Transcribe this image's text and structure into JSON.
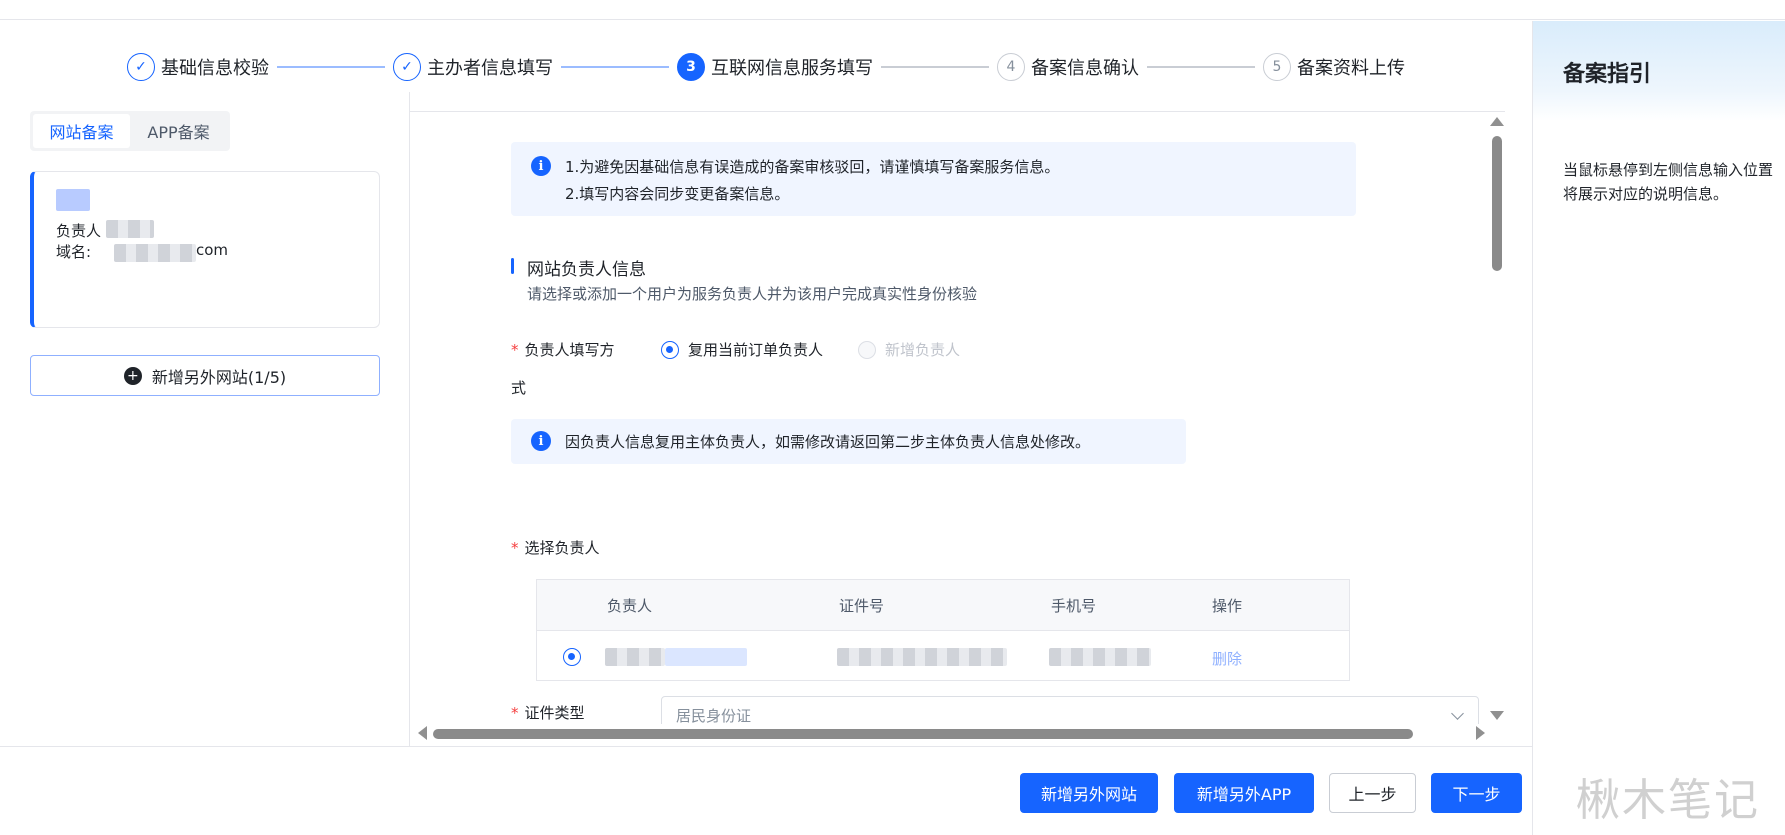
{
  "steps": [
    {
      "num": "✓",
      "label": "基础信息校验",
      "state": "done"
    },
    {
      "num": "✓",
      "label": "主办者信息填写",
      "state": "done"
    },
    {
      "num": "3",
      "label": "互联网信息服务填写",
      "state": "active"
    },
    {
      "num": "4",
      "label": "备案信息确认",
      "state": "todo"
    },
    {
      "num": "5",
      "label": "备案资料上传",
      "state": "todo"
    }
  ],
  "left": {
    "tabs": [
      "网站备案",
      "APP备案"
    ],
    "card": {
      "owner_label": "负责人",
      "domain_label": "域名:",
      "domain_value": "com"
    },
    "add_site": "新增另外网站(1/5)"
  },
  "content": {
    "notice1": [
      "1.为避免因基础信息有误造成的备案审核驳回，请谨慎填写备案服务信息。",
      "2.填写内容会同步变更备案信息。"
    ],
    "section_title": "网站负责人信息",
    "section_sub": "请选择或添加一个用户为服务负责人并为该用户完成真实性身份核验",
    "fill_mode_label": "负责人填写方",
    "fill_mode_wrap": "式",
    "fill_options": [
      "复用当前订单负责人",
      "新增负责人"
    ],
    "notice2": "因负责人信息复用主体负责人，如需修改请返回第二步主体负责人信息处修改。",
    "select_label": "选择负责人",
    "table_headers": [
      "负责人",
      "证件号",
      "手机号",
      "操作"
    ],
    "row_action": "删除",
    "cert_type_label": "证件类型",
    "cert_type_value": "居民身份证"
  },
  "footer": {
    "buttons": [
      "新增另外网站",
      "新增另外APP",
      "上一步",
      "下一步"
    ]
  },
  "guide": {
    "title": "备案指引",
    "text": [
      "当鼠标悬停到左侧信息输入位置",
      "将展示对应的说明信息。"
    ]
  },
  "watermark": "楸木笔记"
}
